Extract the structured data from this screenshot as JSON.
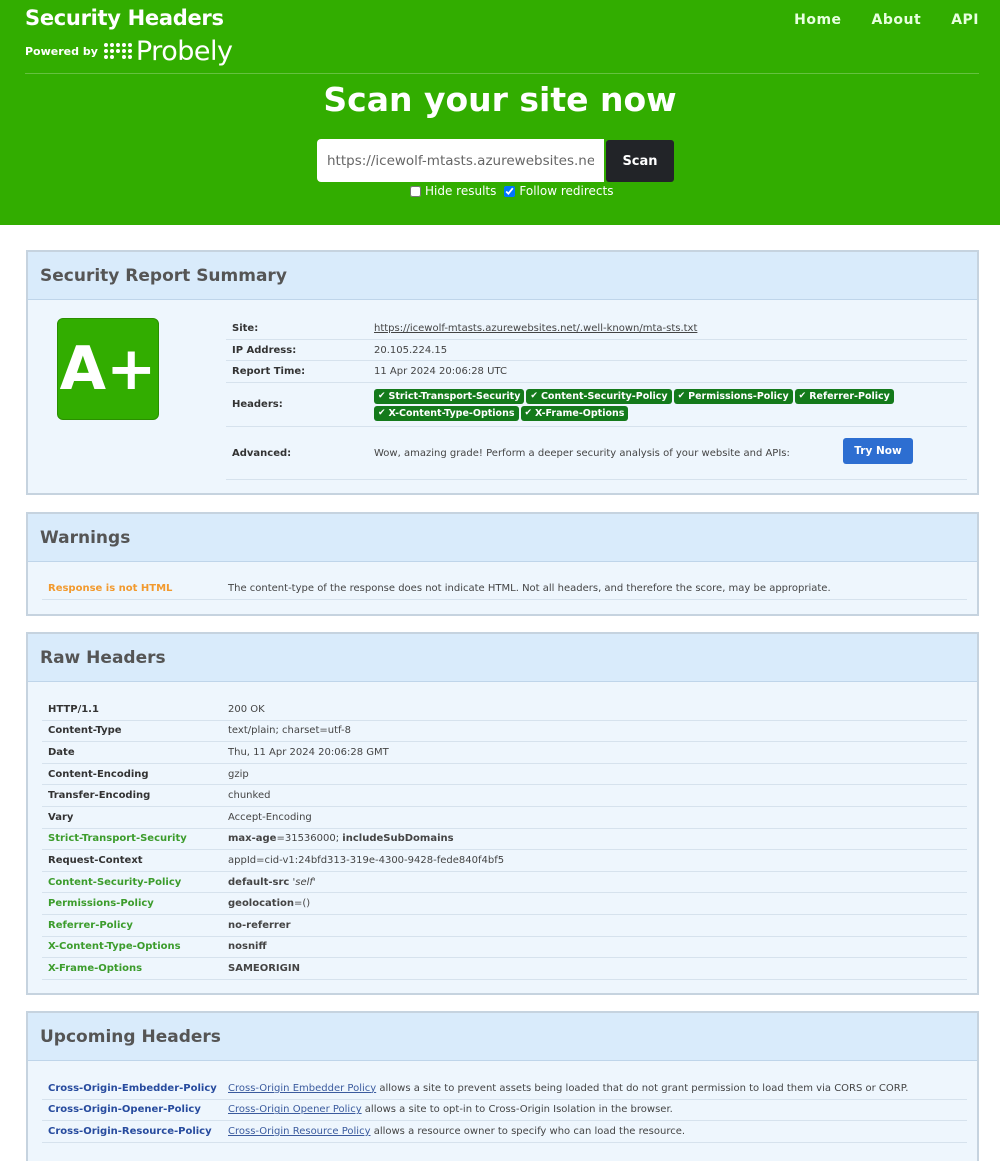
{
  "header": {
    "title": "Security Headers",
    "powered_by": "Powered by",
    "sponsor": "Probely",
    "nav": [
      "Home",
      "About",
      "API"
    ],
    "scan_title": "Scan your site now",
    "scan_input_value": "https://icewolf-mtasts.azurewebsites.net",
    "scan_button": "Scan",
    "hide_results": "Hide results",
    "follow_redirects": "Follow redirects"
  },
  "summary": {
    "heading": "Security Report Summary",
    "grade": "A+",
    "site_label": "Site:",
    "site_value": "https://icewolf-mtasts.azurewebsites.net/.well-known/mta-sts.txt",
    "ip_label": "IP Address:",
    "ip_value": "20.105.224.15",
    "time_label": "Report Time:",
    "time_value": "11 Apr 2024 20:06:28 UTC",
    "headers_label": "Headers:",
    "headers": [
      "Strict-Transport-Security",
      "Content-Security-Policy",
      "Permissions-Policy",
      "Referrer-Policy",
      "X-Content-Type-Options",
      "X-Frame-Options"
    ],
    "advanced_label": "Advanced:",
    "advanced_value": "Wow, amazing grade! Perform a deeper security analysis of your website and APIs:",
    "try_button": "Try Now"
  },
  "warnings": {
    "heading": "Warnings",
    "items": [
      {
        "key": "Response is not HTML",
        "value": "The content-type of the response does not indicate HTML. Not all headers, and therefore the score, may be appropriate."
      }
    ]
  },
  "raw": {
    "heading": "Raw Headers",
    "rows": [
      {
        "key": "HTTP/1.1",
        "value": "200 OK"
      },
      {
        "key": "Content-Type",
        "value": "text/plain; charset=utf-8"
      },
      {
        "key": "Date",
        "value": "Thu, 11 Apr 2024 20:06:28 GMT"
      },
      {
        "key": "Content-Encoding",
        "value": "gzip"
      },
      {
        "key": "Transfer-Encoding",
        "value": "chunked"
      },
      {
        "key": "Vary",
        "value": "Accept-Encoding"
      },
      {
        "key": "Strict-Transport-Security",
        "v1": "max-age",
        "v2": "=31536000; ",
        "v3": "includeSubDomains"
      },
      {
        "key": "Request-Context",
        "value": "appId=cid-v1:24bfd313-319e-4300-9428-fede840f4bf5"
      },
      {
        "key": "Content-Security-Policy",
        "v1": "default-src",
        "v2": " ",
        "v3": "'self'"
      },
      {
        "key": "Permissions-Policy",
        "v1": "geolocation",
        "v2": "=()"
      },
      {
        "key": "Referrer-Policy",
        "v1": "no-referrer"
      },
      {
        "key": "X-Content-Type-Options",
        "v1": "nosniff"
      },
      {
        "key": "X-Frame-Options",
        "v1": "SAMEORIGIN"
      }
    ]
  },
  "upcoming": {
    "heading": "Upcoming Headers",
    "rows": [
      {
        "key": "Cross-Origin-Embedder-Policy",
        "link": "Cross-Origin Embedder Policy",
        "rest": " allows a site to prevent assets being loaded that do not grant permission to load them via CORS or CORP."
      },
      {
        "key": "Cross-Origin-Opener-Policy",
        "link": "Cross-Origin Opener Policy",
        "rest": " allows a site to opt-in to Cross-Origin Isolation in the browser."
      },
      {
        "key": "Cross-Origin-Resource-Policy",
        "link": "Cross-Origin Resource Policy",
        "rest": " allows a resource owner to specify who can load the resource."
      }
    ]
  }
}
